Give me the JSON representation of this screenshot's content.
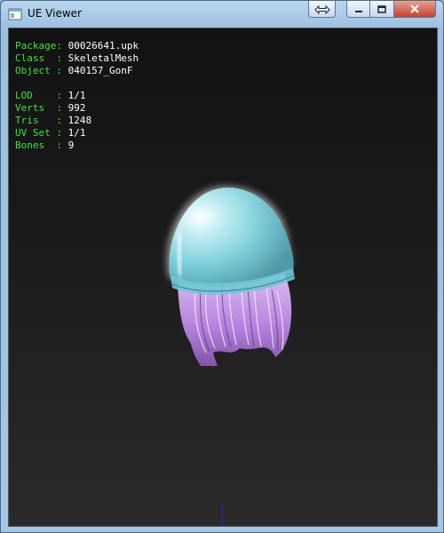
{
  "window": {
    "title": "UE Viewer",
    "buttons": {
      "swap": "swap-arrows-icon",
      "minimize": "minimize-icon",
      "maximize": "maximize-icon",
      "close": "close-icon"
    }
  },
  "info": {
    "package": {
      "label": "Package: ",
      "value": "00026641.upk"
    },
    "class": {
      "label": "Class  : ",
      "value": "SkeletalMesh"
    },
    "object": {
      "label": "Object : ",
      "value": "040157_GonF"
    },
    "lod": {
      "label": "LOD    : ",
      "value": "1/1"
    },
    "verts": {
      "label": "Verts  : ",
      "value": "992"
    },
    "tris": {
      "label": "Tris   : ",
      "value": "1248"
    },
    "uvset": {
      "label": "UV Set : ",
      "value": "1/1"
    },
    "bones": {
      "label": "Bones  : ",
      "value": "9"
    }
  },
  "colors": {
    "label_green": "#3ee23e",
    "value_white": "#ffffff",
    "viewport_bg": "#1a1a1a",
    "hat_cyan": "#7ed0dc",
    "hair_purple": "#c08ae0",
    "axis_blue": "#2a2ad0"
  },
  "model": {
    "name": "hair-with-beanie-mesh"
  }
}
